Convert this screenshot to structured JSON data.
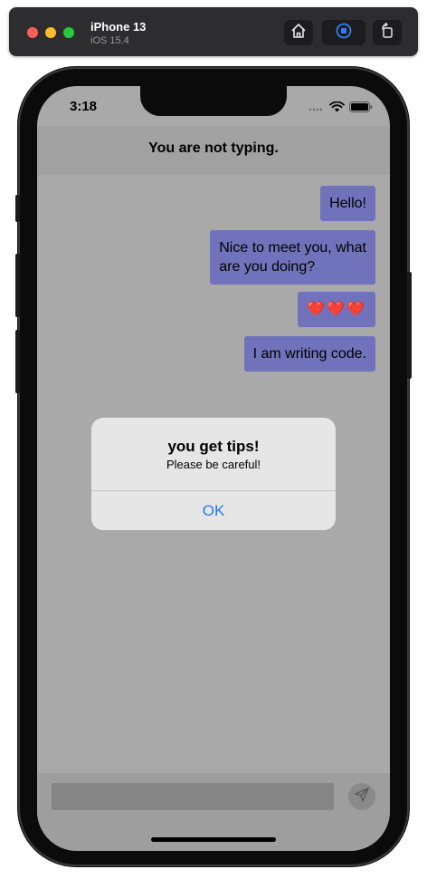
{
  "toolbar": {
    "device_name": "iPhone 13",
    "os_version": "iOS 15.4",
    "icons": [
      "home-icon",
      "record-icon",
      "rotate-icon"
    ]
  },
  "status_bar": {
    "time": "3:18",
    "icons": [
      "signal-icon",
      "wifi-icon",
      "battery-icon"
    ]
  },
  "chat": {
    "title": "You are not typing.",
    "bubble_color": "#7072bb",
    "messages": [
      {
        "text": "Hello!"
      },
      {
        "text": "Nice to meet you, what\nare you doing?"
      },
      {
        "text": "❤️❤️❤️"
      },
      {
        "text": "I am writing code."
      }
    ],
    "input": {
      "value": "",
      "placeholder": ""
    },
    "send_icon": "send-icon"
  },
  "alert": {
    "title": "you get tips!",
    "message": "Please be careful!",
    "button_label": "OK",
    "button_color": "#1f7af6"
  }
}
